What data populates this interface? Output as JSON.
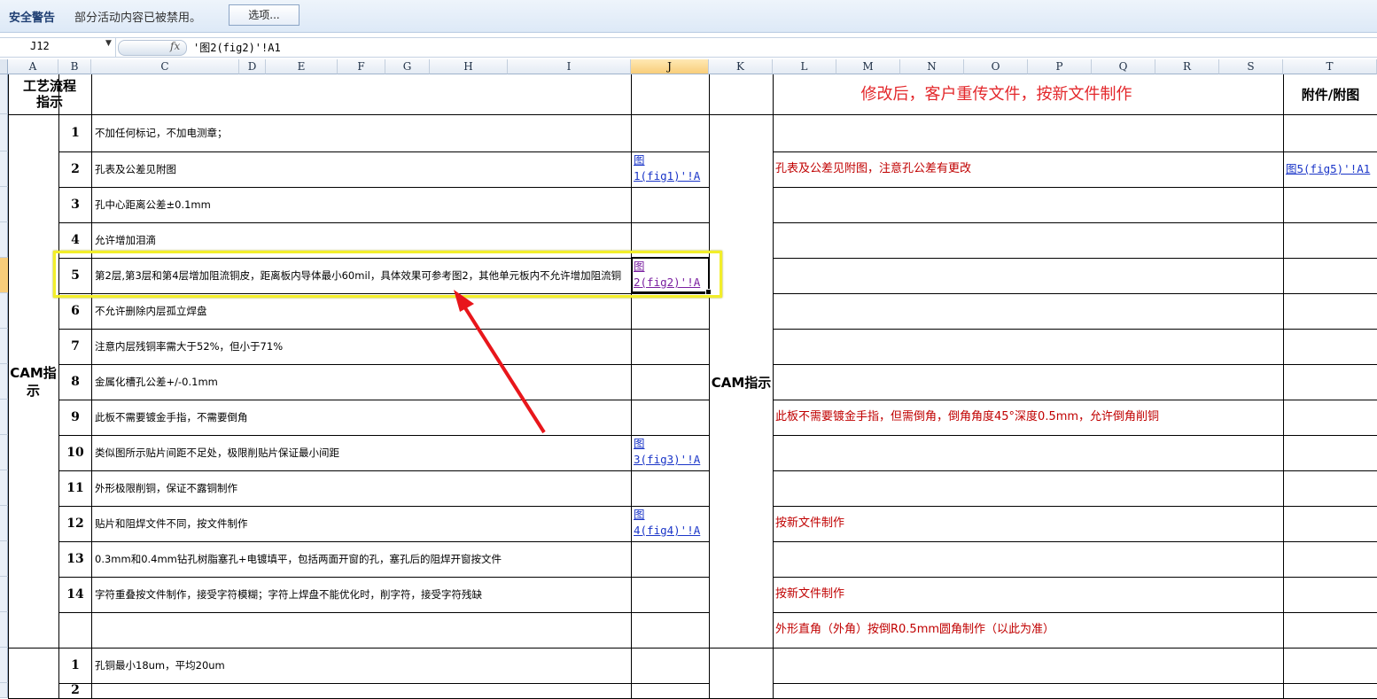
{
  "security_bar": {
    "title": "安全警告",
    "message": "部分活动内容已被禁用。",
    "options_button": "选项..."
  },
  "formula_bar": {
    "name_box": "J12",
    "fx_label": "fx",
    "formula": "'图2(fig2)'!A1"
  },
  "columns": [
    "A",
    "B",
    "C",
    "D",
    "E",
    "F",
    "G",
    "H",
    "I",
    "J",
    "K",
    "L",
    "M",
    "N",
    "O",
    "P",
    "Q",
    "R",
    "S",
    "T"
  ],
  "selected_column": "J",
  "headers": {
    "left_title": "工艺流程\n指示",
    "right_title": "修改后，客户重传文件，按新文件制作",
    "attachment_title": "附件/附图",
    "cam_left": "CAM指\n示",
    "cam_right": "CAM指示"
  },
  "rows": [
    {
      "num": "1",
      "text": "不加任何标记，不加电测章；",
      "link": "",
      "modified": "",
      "attachment": ""
    },
    {
      "num": "2",
      "text": "孔表及公差见附图",
      "link": "图\n1(fig1)'!A",
      "modified": "孔表及公差见附图，注意孔公差有更改",
      "attachment": "图5(fig5)'!A1"
    },
    {
      "num": "3",
      "text": "孔中心距离公差±0.1mm",
      "link": "",
      "modified": "",
      "attachment": ""
    },
    {
      "num": "4",
      "text": "允许增加泪滴",
      "link": "",
      "modified": "",
      "attachment": ""
    },
    {
      "num": "5",
      "text": "第2层,第3层和第4层增加阻流铜皮，距离板内导体最小60mil，具体效果可参考图2，其他单元板内不允许增加阻流铜",
      "link": "图\n2(fig2)'!A",
      "modified": "",
      "attachment": ""
    },
    {
      "num": "6",
      "text": "不允许删除内层孤立焊盘",
      "link": "",
      "modified": "",
      "attachment": ""
    },
    {
      "num": "7",
      "text": "注意内层残铜率需大于52%，但小于71%",
      "link": "",
      "modified": "",
      "attachment": ""
    },
    {
      "num": "8",
      "text": "金属化槽孔公差+/-0.1mm",
      "link": "",
      "modified": "",
      "attachment": ""
    },
    {
      "num": "9",
      "text": "此板不需要镀金手指，不需要倒角",
      "link": "",
      "modified": "此板不需要镀金手指，但需倒角，倒角角度45°深度0.5mm，允许倒角削铜",
      "attachment": ""
    },
    {
      "num": "10",
      "text": "类似图所示贴片间距不足处，极限削贴片保证最小间距",
      "link": "图\n3(fig3)'!A",
      "modified": "",
      "attachment": ""
    },
    {
      "num": "11",
      "text": "外形极限削铜，保证不露铜制作",
      "link": "",
      "modified": "",
      "attachment": ""
    },
    {
      "num": "12",
      "text": "贴片和阻焊文件不同，按文件制作",
      "link": "图\n4(fig4)'!A",
      "modified": "按新文件制作",
      "attachment": ""
    },
    {
      "num": "13",
      "text": "0.3mm和0.4mm钻孔树脂塞孔+电镀填平，包括两面开窗的孔，塞孔后的阻焊开窗按文件",
      "link": "",
      "modified": "",
      "attachment": ""
    },
    {
      "num": "14",
      "text": "字符重叠按文件制作，接受字符模糊；字符上焊盘不能优化时，削字符，接受字符残缺",
      "link": "",
      "modified": "按新文件制作",
      "attachment": ""
    },
    {
      "num": "",
      "text": "",
      "link": "",
      "modified": "外形直角（外角）按倒R0.5mm圆角制作（以此为准）",
      "attachment": ""
    },
    {
      "num": "1",
      "text": "孔铜最小18um，平均20um",
      "link": "",
      "modified": "",
      "attachment": ""
    },
    {
      "num": "2",
      "text": "",
      "link": "",
      "modified": "",
      "attachment": ""
    }
  ],
  "annotation_color": "#e8161b",
  "highlight_color": "#f2ee2a"
}
